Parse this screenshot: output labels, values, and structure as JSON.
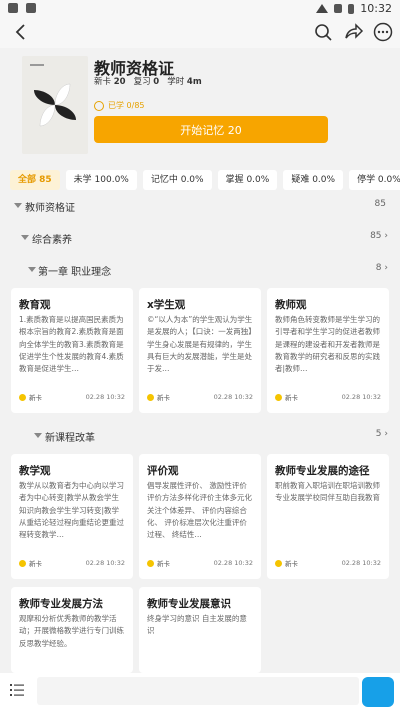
{
  "header": {
    "title": "教师资格证",
    "stats": {
      "card_label": "新卡",
      "card_count": "20",
      "review_label": "复习",
      "review_count": "0",
      "time_label": "学时",
      "time_value": "4m"
    },
    "progress": "已学 0/85",
    "start_button": "开始记忆 20"
  },
  "filters": [
    {
      "label": "全部 85"
    },
    {
      "label": "未学 100.0%"
    },
    {
      "label": "记忆中 0.0%"
    },
    {
      "label": "掌握 0.0%"
    },
    {
      "label": "疑难 0.0%"
    },
    {
      "label": "停学 0.0%"
    }
  ],
  "tree": {
    "root": {
      "label": "教师资格证",
      "count": "85"
    },
    "section": {
      "label": "综合素养",
      "count": "85"
    },
    "chapter1": {
      "label": "第一章 职业理念",
      "count": "8"
    },
    "chapter2": {
      "label": "新课程改革",
      "count": "5"
    }
  },
  "cards_group1": [
    {
      "title": "教育观",
      "body": "1.素质教育是以提高国民素质为根本宗旨的教育2.素质教育是面向全体学生的教育3.素质教育是促进学生个性发展的教育4.素质教育是促进学生…",
      "tag": "新卡",
      "date": "02.28 10:32"
    },
    {
      "title": "x学生观",
      "body": "©“以人为本”的学生观认为学生是发展的人；【口诀：一发两独】学生身心发展是有规律的，学生具有巨大的发展潜能，学生是处于发…",
      "tag": "新卡",
      "date": "02.28 10:32"
    },
    {
      "title": "教师观",
      "body": "教师角色转变教师是学生学习的引导者和学生学习的促进者教师是课程的建设者和开发者教师是教育教学的研究者和反思的实践者|教师…",
      "tag": "新卡",
      "date": "02.28 10:32"
    }
  ],
  "cards_group2": [
    {
      "title": "教学观",
      "body": "教学从以教育者为中心向以学习者为中心转变|教学从教会学生知识向教会学生学习转变|教学从重结论轻过程向重结论更重过程转变教学…",
      "tag": "新卡",
      "date": "02.28 10:32"
    },
    {
      "title": "评价观",
      "body": "倡导发展性评价、 激励性评价评价方法多样化评价主体多元化关注个体差异、 评价内容综合化、 评价标准层次化注重评价过程、 终结性…",
      "tag": "新卡",
      "date": "02.28 10:32"
    },
    {
      "title": "教师专业发展的途径",
      "body": "职前教育入职培训在职培训教师专业发展学校同伴互助自我教育",
      "tag": "新卡",
      "date": "02.28 10:32"
    },
    {
      "title": "教师专业发展方法",
      "body": "观摩和分析优秀教师的教学活动；开展微格教学进行专门训练反思教学经验。",
      "tag": "",
      "date": ""
    },
    {
      "title": "教师专业发展意识",
      "body": "终身学习的意识 自主发展的意识",
      "tag": "",
      "date": ""
    }
  ],
  "status": {
    "time": "10:32"
  },
  "colors": {
    "accent": "#f7a500",
    "background": "#f2f2f2"
  }
}
